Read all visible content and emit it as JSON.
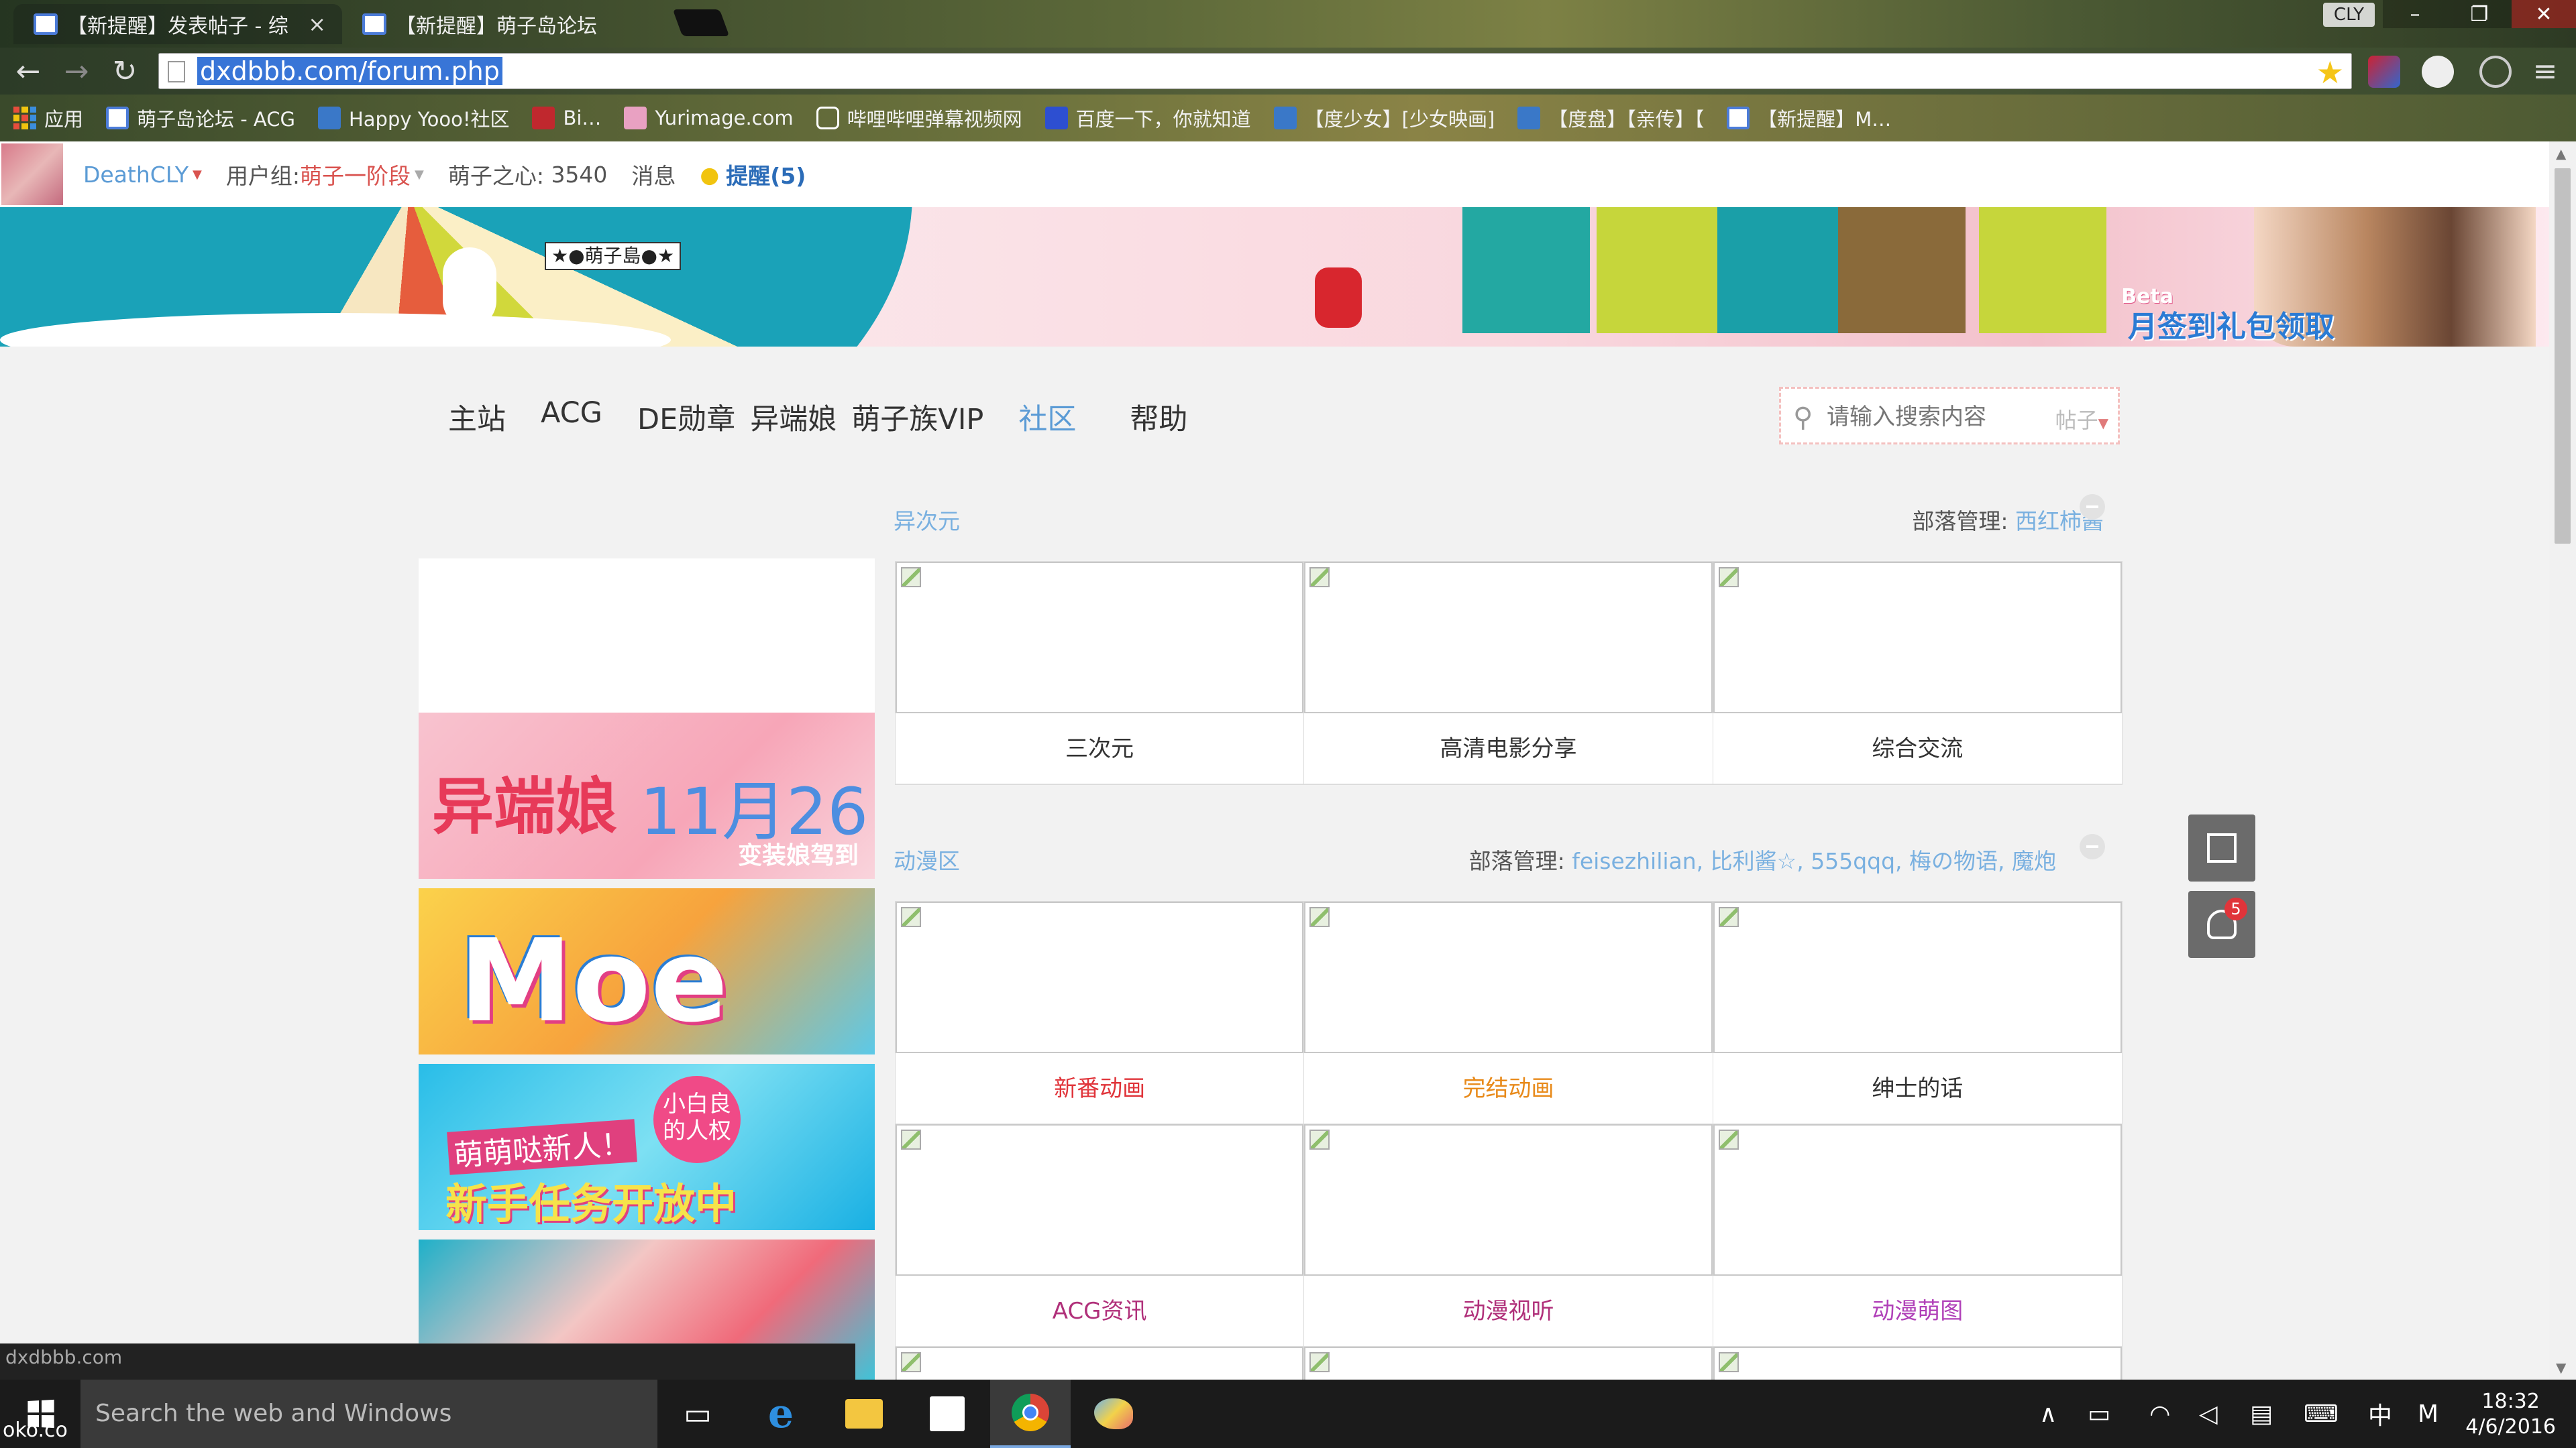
{
  "browser": {
    "tabs": [
      {
        "title": "【新提醒】发表帖子 - 综",
        "active": true
      },
      {
        "title": "【新提醒】萌子岛论坛",
        "active": false
      }
    ],
    "profile": "CLY",
    "url": "dxdbbb.com/forum.php",
    "bookmarks": [
      {
        "label": "应用",
        "icon": "apps-grid-icon"
      },
      {
        "label": "萌子岛论坛 - ACG",
        "icon": "forum-icon"
      },
      {
        "label": "Happy Yooo!社区",
        "icon": "hy-icon"
      },
      {
        "label": "Bi…",
        "icon": "red-icon"
      },
      {
        "label": "Yurimage.com",
        "icon": "yuri-icon"
      },
      {
        "label": "哔哩哔哩弹幕视频网",
        "icon": "bilibili-icon"
      },
      {
        "label": "百度一下，你就知道",
        "icon": "baidu-icon"
      },
      {
        "label": "【度少女】[少女映画]",
        "icon": "hy-icon"
      },
      {
        "label": "【度盘】【亲传】【",
        "icon": "hy-icon"
      },
      {
        "label": "【新提醒】M…",
        "icon": "forum-icon"
      }
    ]
  },
  "userbar": {
    "username": "DeathCLY",
    "group_label": "用户组:",
    "group_value": "萌子一阶段",
    "heart_label": "萌子之心:",
    "heart_value": "3540",
    "messages": "消息",
    "reminders": "提醒(5)"
  },
  "banner": {
    "logo": "★●萌子島●★",
    "beta": "Beta",
    "checkin": "月签到礼包领取"
  },
  "nav": [
    "主站",
    "ACG",
    "DE勋章",
    "异端娘",
    "萌子族VIP",
    "社区",
    "帮助"
  ],
  "nav_active_index": 5,
  "search": {
    "placeholder": "请输入搜索内容",
    "type": "帖子"
  },
  "sidebar_banners": [
    {
      "title": "异端娘",
      "date": "11月26",
      "sub": "变装娘驾到"
    },
    {
      "title": "Moe"
    },
    {
      "small": "萌萌哒新人！",
      "title": "新手任务开放中",
      "bubble": "小白良的人权"
    },
    {}
  ],
  "sections": [
    {
      "title": "异次元",
      "mod_label": "部落管理:",
      "mods": "西红柿酱",
      "forums": [
        {
          "name": "三次元"
        },
        {
          "name": "高清电影分享"
        },
        {
          "name": "综合交流"
        }
      ]
    },
    {
      "title": "动漫区",
      "mod_label": "部落管理:",
      "mods": "feisezhilian, 比利酱☆, 555qqq, 梅の物语, 魔炮",
      "forums": [
        {
          "name": "新番动画",
          "color": "#e0343a"
        },
        {
          "name": "完结动画",
          "color": "#e88a1a"
        },
        {
          "name": "绅士的话"
        },
        {
          "name": "ACG资讯",
          "color": "#b0307a"
        },
        {
          "name": "动漫视听",
          "color": "#b0307a"
        },
        {
          "name": "动漫萌图",
          "color": "#b040b8"
        }
      ]
    }
  ],
  "float_badge": "5",
  "status_url": "dxdbbb.com",
  "taskbar": {
    "search_placeholder": "Search the web and Windows",
    "corner_text": "oko.co",
    "ime": "中",
    "ime2": "M",
    "time": "18:32",
    "date": "4/6/2016"
  }
}
